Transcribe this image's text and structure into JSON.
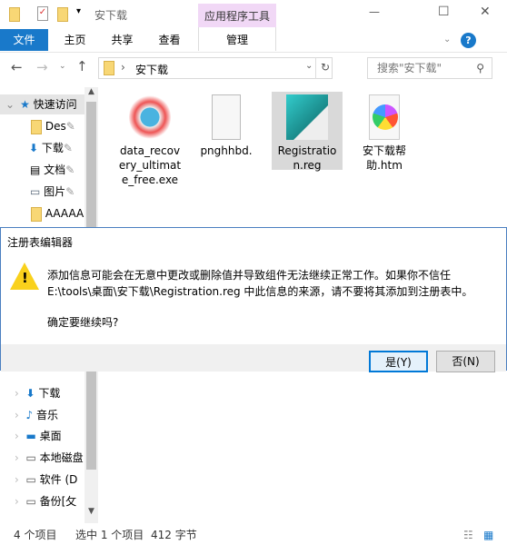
{
  "window": {
    "title": "安下载",
    "context_tab": "应用程序工具",
    "minimize": "—",
    "maximize": "☐",
    "close": "✕"
  },
  "ribbon": {
    "tabs": [
      {
        "label": "文件"
      },
      {
        "label": "主页"
      },
      {
        "label": "共享"
      },
      {
        "label": "查看"
      },
      {
        "label": "管理"
      }
    ],
    "help": "?"
  },
  "address": {
    "path": "安下载",
    "search_placeholder": "搜索\"安下载\""
  },
  "nav": {
    "items": [
      {
        "label": "快速访问"
      },
      {
        "label": "Des"
      },
      {
        "label": "下载"
      },
      {
        "label": "文档"
      },
      {
        "label": "图片"
      },
      {
        "label": "AAAAA"
      }
    ],
    "items_lower": [
      {
        "label": "下载"
      },
      {
        "label": "音乐"
      },
      {
        "label": "桌面"
      },
      {
        "label": "本地磁盘"
      },
      {
        "label": "软件 (D"
      },
      {
        "label": "备份[攵"
      }
    ]
  },
  "files": [
    {
      "name": "data_recovery_ultimate_free.exe"
    },
    {
      "name": "pnghhbd."
    },
    {
      "name": "Registration.reg",
      "selected": true
    },
    {
      "name": "安下载帮助.htm"
    }
  ],
  "dialog": {
    "title": "注册表编辑器",
    "line1": "添加信息可能会在无意中更改或删除值并导致组件无法继续正常工作。如果你不信任",
    "line2": "E:\\tools\\桌面\\安下载\\Registration.reg 中此信息的来源，请不要将其添加到注册表中。",
    "question": "确定要继续吗?",
    "yes": "是(Y)",
    "no": "否(N)"
  },
  "status": {
    "count": "4 个项目",
    "selected": "选中 1 个项目",
    "size": "412 字节"
  },
  "colors": {
    "accent": "#1979ca",
    "context": "#f1d8f6",
    "selection": "#d9d9d9"
  }
}
